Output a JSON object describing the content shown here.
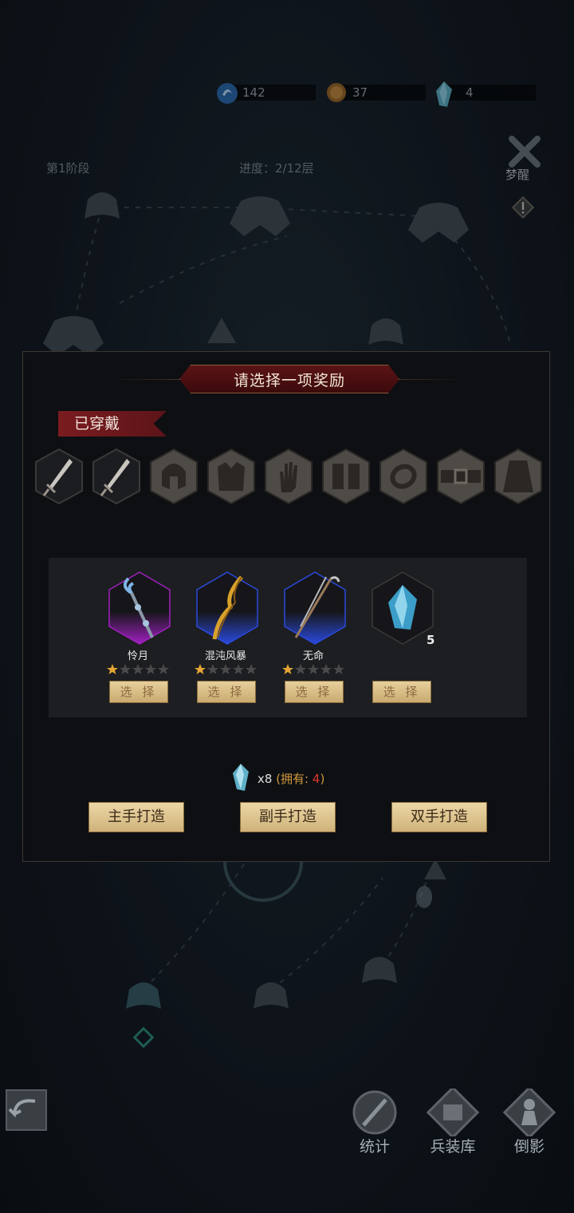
{
  "currency": [
    {
      "name": "spirit-orb",
      "value": "142",
      "color": "#3a8fd8"
    },
    {
      "name": "coin",
      "value": "37",
      "color": "#b07a36"
    },
    {
      "name": "crystal",
      "value": "4",
      "color": "#6cc4e0"
    }
  ],
  "map": {
    "stage_label": "第1阶段",
    "progress_label": "进度：2/12层",
    "wake_label": "梦醒"
  },
  "dialog": {
    "title": "请选择一项奖励",
    "equipped_label": "已穿戴",
    "slots": [
      {
        "icon": "sword-icon",
        "filled": true
      },
      {
        "icon": "sword-icon",
        "filled": true
      },
      {
        "icon": "helmet-icon",
        "filled": false
      },
      {
        "icon": "armor-icon",
        "filled": false
      },
      {
        "icon": "glove-icon",
        "filled": false
      },
      {
        "icon": "boots-icon",
        "filled": false
      },
      {
        "icon": "ring-icon",
        "filled": false
      },
      {
        "icon": "belt-icon",
        "filled": false
      },
      {
        "icon": "cloak-icon",
        "filled": false
      }
    ],
    "rewards": [
      {
        "name": "怜月",
        "stars": 1,
        "max_stars": 5,
        "select_label": "选 择",
        "rarity_color": "#a020c0",
        "icon": "staff-icon"
      },
      {
        "name": "混沌风暴",
        "stars": 1,
        "max_stars": 5,
        "select_label": "选 择",
        "rarity_color": "#2a4adc",
        "icon": "golden-staff-icon"
      },
      {
        "name": "无命",
        "stars": 1,
        "max_stars": 5,
        "select_label": "选 择",
        "rarity_color": "#2a4adc",
        "icon": "scythe-icon"
      },
      {
        "name": "",
        "count": "5",
        "select_label": "选 择",
        "icon": "crystal-icon"
      }
    ],
    "cost": {
      "times": "x8",
      "own_prefix": "(拥有: ",
      "own_value": "4",
      "own_suffix": ")"
    },
    "buttons": {
      "main_hand": "主手打造",
      "off_hand": "副手打造",
      "two_hand": "双手打造"
    }
  },
  "bottom_nav": {
    "stats": "统计",
    "armory": "兵装库",
    "reflection": "倒影"
  }
}
